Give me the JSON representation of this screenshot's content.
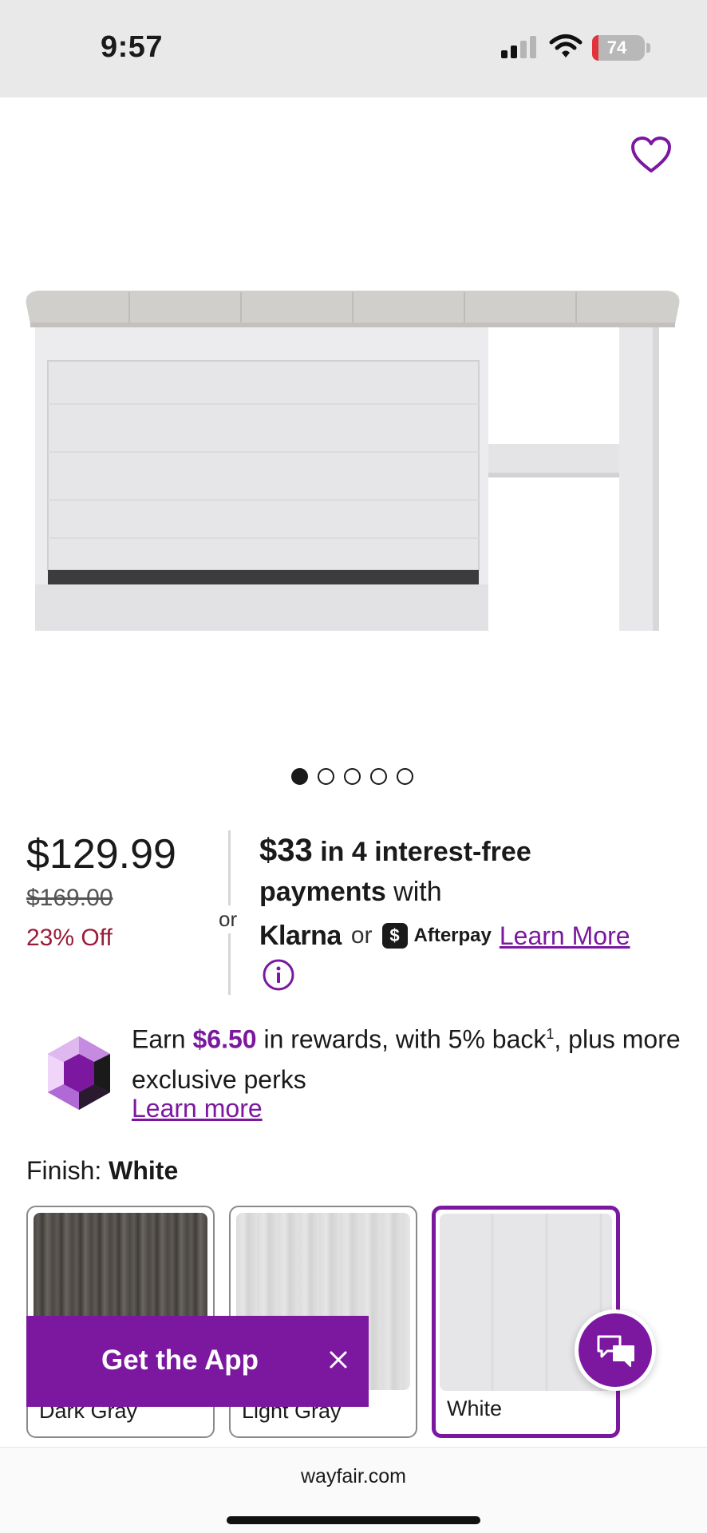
{
  "status_bar": {
    "time": "9:57",
    "battery": "74",
    "icons": [
      "signal-icon",
      "wifi-icon",
      "battery-icon"
    ]
  },
  "carousel": {
    "count": 5,
    "active_index": 0
  },
  "pricing": {
    "price": "$129.99",
    "original_price": "$169.00",
    "discount": "23% Off",
    "or_label": "or",
    "installment_amount": "$33",
    "installment_text_1": " in 4 interest-free",
    "installment_text_2": "payments",
    "installment_text_3": " with",
    "klarna": "Klarna",
    "pay_or": "or",
    "afterpay_badge": "$",
    "afterpay": "Afterpay",
    "learn_more": "Learn More"
  },
  "rewards": {
    "prefix": "Earn ",
    "amount": "$6.50",
    "middle": " in rewards, with 5% back",
    "superscript": "1",
    "suffix": ", plus more exclusive perks",
    "learn_more": "Learn more"
  },
  "finish": {
    "label": "Finish: ",
    "selected": "White",
    "options": [
      {
        "label": "Dark Gray"
      },
      {
        "label": "Light Gray"
      },
      {
        "label": "White"
      }
    ]
  },
  "app_banner": {
    "label": "Get the App"
  },
  "footer": {
    "url": "wayfair.com"
  },
  "colors": {
    "brand_purple": "#7b189f",
    "discount_red": "#9b1b3a"
  }
}
